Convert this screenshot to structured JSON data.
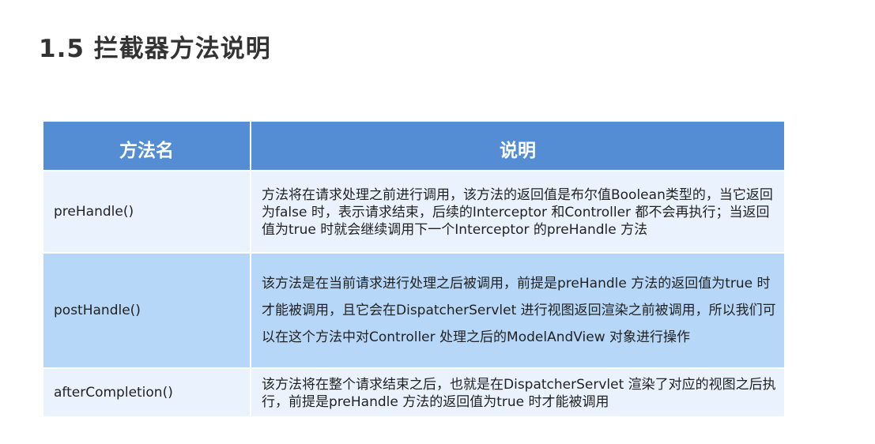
{
  "page": {
    "title": "1.5 拦截器方法说明"
  },
  "table": {
    "headers": [
      "方法名",
      "说明"
    ],
    "rows": [
      {
        "name": "preHandle()",
        "description": "方法将在请求处理之前进行调用，该方法的返回值是布尔值Boolean类型的，当它返回为false 时，表示请求结束，后续的Interceptor 和Controller 都不会再执行；当返回值为true 时就会继续调用下一个Interceptor 的preHandle 方法"
      },
      {
        "name": "postHandle()",
        "description": "该方法是在当前请求进行处理之后被调用，前提是preHandle 方法的返回值为true 时才能被调用，且它会在DispatcherServlet 进行视图返回渲染之前被调用，所以我们可以在这个方法中对Controller 处理之后的ModelAndView 对象进行操作"
      },
      {
        "name": "afterCompletion()",
        "description": "该方法将在整个请求结束之后，也就是在DispatcherServlet 渲染了对应的视图之后执行，前提是preHandle 方法的返回值为true 时才能被调用"
      }
    ]
  },
  "colors": {
    "header_bg": "#548dd4",
    "row_light": "#eaf3fd",
    "row_highlight": "#b6d7f7"
  }
}
